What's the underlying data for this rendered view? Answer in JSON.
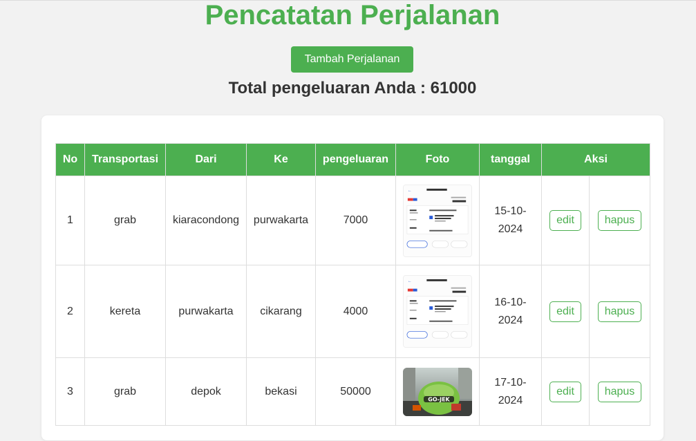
{
  "page_title": "Pencatatan Perjalanan",
  "add_button_label": "Tambah Perjalanan",
  "total_text": "Total pengeluaran Anda : 61000",
  "table": {
    "headers": [
      "No",
      "Transportasi",
      "Dari",
      "Ke",
      "pengeluaran",
      "Foto",
      "tanggal",
      "Aksi"
    ],
    "rows": [
      {
        "no": "1",
        "transport": "grab",
        "from": "kiaracondong",
        "to": "purwakarta",
        "cost": "7000",
        "photo": "receipt-image",
        "date": "15-10-2024",
        "edit": "edit",
        "delete": "hapus"
      },
      {
        "no": "2",
        "transport": "kereta",
        "from": "purwakarta",
        "to": "cikarang",
        "cost": "4000",
        "photo": "receipt-image",
        "date": "16-10-2024",
        "edit": "edit",
        "delete": "hapus"
      },
      {
        "no": "3",
        "transport": "grab",
        "from": "depok",
        "to": "bekasi",
        "cost": "50000",
        "photo": "gojek-helmet-photo",
        "date": "17-10-2024",
        "edit": "edit",
        "delete": "hapus"
      }
    ]
  },
  "colors": {
    "accent": "#4caf50",
    "background": "#f2f2f2",
    "card": "#ffffff"
  }
}
